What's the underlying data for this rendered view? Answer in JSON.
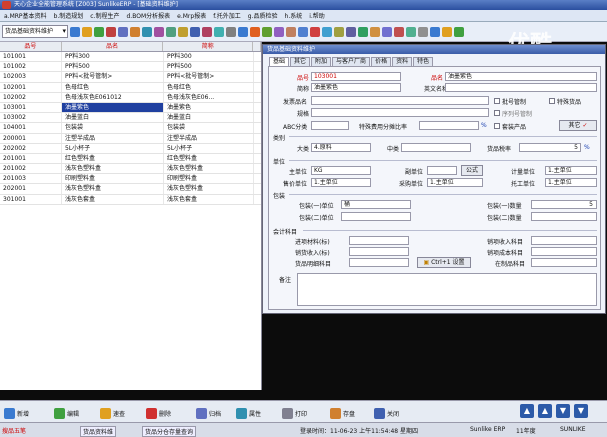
{
  "window": {
    "title": "天心企业全能管理系统 [Z003] SunlikeERP - [基础资料维护]"
  },
  "menu": [
    "a.MRP基本资料",
    "b.制造规划",
    "c.制程生产",
    "d.BOM分析报表",
    "e.Mrp报表",
    "f.托外加工",
    "g.品质检验",
    "h.系统",
    "i.帮助"
  ],
  "toolbar": {
    "module": "货品基础资料维护"
  },
  "grid": {
    "headers": [
      "品号",
      "品名",
      "简称",
      ""
    ],
    "rows": [
      [
        "101001",
        "PP料300",
        "PP料300"
      ],
      [
        "101002",
        "PP料500",
        "PP料500"
      ],
      [
        "102003",
        "PP料<批号管制>",
        "PP料<批号管制>"
      ],
      [
        "102001",
        "色母红色",
        "色母红色"
      ],
      [
        "102002",
        "色母浅灰色E061012",
        "色母浅灰色E06..."
      ],
      [
        "103001",
        "油墨紫色",
        "油墨紫色"
      ],
      [
        "103002",
        "油墨蓝白",
        "油墨蓝白"
      ],
      [
        "104001",
        "包装袋",
        "包装袋"
      ],
      [
        "200001",
        "注塑半成品",
        "注塑半成品"
      ],
      [
        "202002",
        "5L小杯子",
        "5L小杯子"
      ],
      [
        "201001",
        "红色塑料盒",
        "红色塑料盒"
      ],
      [
        "201002",
        "浅灰色塑料盒",
        "浅灰色塑料盒"
      ],
      [
        "201003",
        "印刷塑料盒",
        "印刷塑料盒"
      ],
      [
        "202001",
        "浅灰色塑料盒",
        "浅灰色塑料盒"
      ],
      [
        "301001",
        "浅灰色套盒",
        "浅灰色套盒"
      ]
    ],
    "selected_row": 5
  },
  "dialog": {
    "title": "货品基础资料维护",
    "tabs": [
      "基础",
      "其它",
      "附加",
      "与客户厂商",
      "价格",
      "资料",
      "特色"
    ],
    "labels": {
      "item_no": "品号",
      "name": "品名",
      "short": "简称",
      "en_name": "英文名称",
      "desc": "发票品名",
      "spec": "规格",
      "abc": "ABC分类",
      "special_ratio": "特殊费用分摊比率",
      "category": "类别",
      "big_class": "大类",
      "mid_class": "中类",
      "tax_rate": "货品税率",
      "unit_group": "单位",
      "main_unit": "主单位",
      "sub_unit": "副单位",
      "formula": "公式",
      "calc_unit": "计量单位",
      "price_unit": "售价单位",
      "buy_unit": "采购单位",
      "outsource_unit": "托工单位",
      "pack": "包装",
      "pack1": "包装(一)单位",
      "pack2": "包装(二)单位",
      "pack1_qty": "包装(一)数量",
      "pack2_qty": "包装(二)数量",
      "accounts": "会计科目",
      "acc1": "进项材料(标)",
      "acc2": "销货收入(标)",
      "acc3": "货品明细科目",
      "acc4": "销项收入科目",
      "acc5": "销项成本科目",
      "acc6": "在制品科目",
      "remark": "备注"
    },
    "values": {
      "item_no": "103001",
      "name": "油墨紫色",
      "short": "油墨紫色",
      "abc": "",
      "ratio_unit": "%",
      "big_class": "4.原料",
      "tax_rate": "5",
      "tax_unit": "%",
      "main_unit": "KG",
      "calc_unit": "1.主单位",
      "price_unit": "1.主单位",
      "buy_unit": "1.主单位",
      "outsource_unit": "1.主单位",
      "pack1": "桶",
      "pack1_qty": "5"
    },
    "checkboxes": [
      "批号管制",
      "特殊货品",
      "序列号管制",
      "套装产品"
    ],
    "buttons": {
      "other": "其它",
      "ctrl_set": "Ctrl+1 设置"
    }
  },
  "bottom": {
    "buttons": [
      "新增",
      "编辑",
      "速查",
      "删除",
      "归档",
      "属性",
      "打印",
      "存盘",
      "关闭"
    ]
  },
  "status": {
    "login": "登录时间：11-06-23 上午11:54:48 星期四",
    "product": "Sunlike ERP",
    "year": "11年度",
    "user": "SUNLIKE",
    "taskbar": [
      "货品资料维",
      "货品分仓存量查询"
    ],
    "ime": "搜品五笔"
  },
  "watermark": "优酷",
  "colors": {
    "selection": "#2040a0",
    "accent": "#c00000"
  }
}
